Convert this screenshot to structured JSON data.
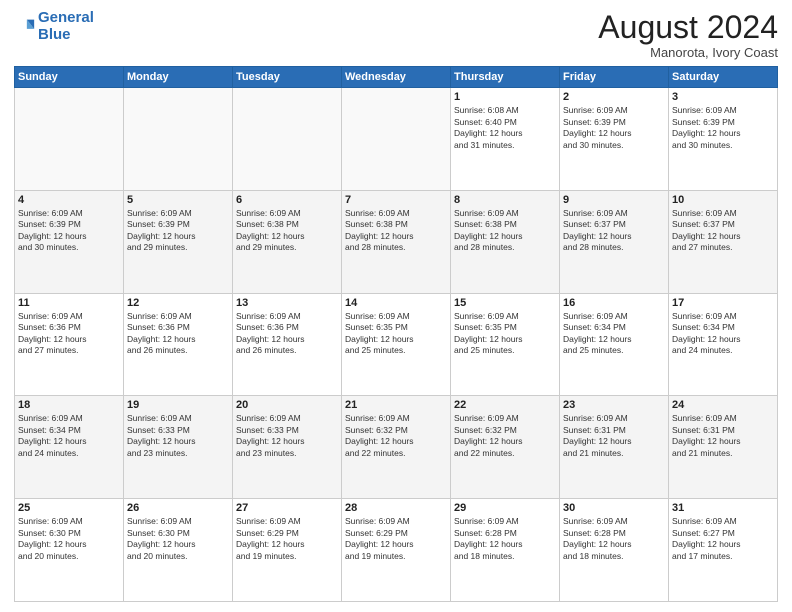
{
  "header": {
    "logo_line1": "General",
    "logo_line2": "Blue",
    "month_year": "August 2024",
    "location": "Manorota, Ivory Coast"
  },
  "weekdays": [
    "Sunday",
    "Monday",
    "Tuesday",
    "Wednesday",
    "Thursday",
    "Friday",
    "Saturday"
  ],
  "weeks": [
    [
      {
        "day": "",
        "info": ""
      },
      {
        "day": "",
        "info": ""
      },
      {
        "day": "",
        "info": ""
      },
      {
        "day": "",
        "info": ""
      },
      {
        "day": "1",
        "info": "Sunrise: 6:08 AM\nSunset: 6:40 PM\nDaylight: 12 hours\nand 31 minutes."
      },
      {
        "day": "2",
        "info": "Sunrise: 6:09 AM\nSunset: 6:39 PM\nDaylight: 12 hours\nand 30 minutes."
      },
      {
        "day": "3",
        "info": "Sunrise: 6:09 AM\nSunset: 6:39 PM\nDaylight: 12 hours\nand 30 minutes."
      }
    ],
    [
      {
        "day": "4",
        "info": "Sunrise: 6:09 AM\nSunset: 6:39 PM\nDaylight: 12 hours\nand 30 minutes."
      },
      {
        "day": "5",
        "info": "Sunrise: 6:09 AM\nSunset: 6:39 PM\nDaylight: 12 hours\nand 29 minutes."
      },
      {
        "day": "6",
        "info": "Sunrise: 6:09 AM\nSunset: 6:38 PM\nDaylight: 12 hours\nand 29 minutes."
      },
      {
        "day": "7",
        "info": "Sunrise: 6:09 AM\nSunset: 6:38 PM\nDaylight: 12 hours\nand 28 minutes."
      },
      {
        "day": "8",
        "info": "Sunrise: 6:09 AM\nSunset: 6:38 PM\nDaylight: 12 hours\nand 28 minutes."
      },
      {
        "day": "9",
        "info": "Sunrise: 6:09 AM\nSunset: 6:37 PM\nDaylight: 12 hours\nand 28 minutes."
      },
      {
        "day": "10",
        "info": "Sunrise: 6:09 AM\nSunset: 6:37 PM\nDaylight: 12 hours\nand 27 minutes."
      }
    ],
    [
      {
        "day": "11",
        "info": "Sunrise: 6:09 AM\nSunset: 6:36 PM\nDaylight: 12 hours\nand 27 minutes."
      },
      {
        "day": "12",
        "info": "Sunrise: 6:09 AM\nSunset: 6:36 PM\nDaylight: 12 hours\nand 26 minutes."
      },
      {
        "day": "13",
        "info": "Sunrise: 6:09 AM\nSunset: 6:36 PM\nDaylight: 12 hours\nand 26 minutes."
      },
      {
        "day": "14",
        "info": "Sunrise: 6:09 AM\nSunset: 6:35 PM\nDaylight: 12 hours\nand 25 minutes."
      },
      {
        "day": "15",
        "info": "Sunrise: 6:09 AM\nSunset: 6:35 PM\nDaylight: 12 hours\nand 25 minutes."
      },
      {
        "day": "16",
        "info": "Sunrise: 6:09 AM\nSunset: 6:34 PM\nDaylight: 12 hours\nand 25 minutes."
      },
      {
        "day": "17",
        "info": "Sunrise: 6:09 AM\nSunset: 6:34 PM\nDaylight: 12 hours\nand 24 minutes."
      }
    ],
    [
      {
        "day": "18",
        "info": "Sunrise: 6:09 AM\nSunset: 6:34 PM\nDaylight: 12 hours\nand 24 minutes."
      },
      {
        "day": "19",
        "info": "Sunrise: 6:09 AM\nSunset: 6:33 PM\nDaylight: 12 hours\nand 23 minutes."
      },
      {
        "day": "20",
        "info": "Sunrise: 6:09 AM\nSunset: 6:33 PM\nDaylight: 12 hours\nand 23 minutes."
      },
      {
        "day": "21",
        "info": "Sunrise: 6:09 AM\nSunset: 6:32 PM\nDaylight: 12 hours\nand 22 minutes."
      },
      {
        "day": "22",
        "info": "Sunrise: 6:09 AM\nSunset: 6:32 PM\nDaylight: 12 hours\nand 22 minutes."
      },
      {
        "day": "23",
        "info": "Sunrise: 6:09 AM\nSunset: 6:31 PM\nDaylight: 12 hours\nand 21 minutes."
      },
      {
        "day": "24",
        "info": "Sunrise: 6:09 AM\nSunset: 6:31 PM\nDaylight: 12 hours\nand 21 minutes."
      }
    ],
    [
      {
        "day": "25",
        "info": "Sunrise: 6:09 AM\nSunset: 6:30 PM\nDaylight: 12 hours\nand 20 minutes."
      },
      {
        "day": "26",
        "info": "Sunrise: 6:09 AM\nSunset: 6:30 PM\nDaylight: 12 hours\nand 20 minutes."
      },
      {
        "day": "27",
        "info": "Sunrise: 6:09 AM\nSunset: 6:29 PM\nDaylight: 12 hours\nand 19 minutes."
      },
      {
        "day": "28",
        "info": "Sunrise: 6:09 AM\nSunset: 6:29 PM\nDaylight: 12 hours\nand 19 minutes."
      },
      {
        "day": "29",
        "info": "Sunrise: 6:09 AM\nSunset: 6:28 PM\nDaylight: 12 hours\nand 18 minutes."
      },
      {
        "day": "30",
        "info": "Sunrise: 6:09 AM\nSunset: 6:28 PM\nDaylight: 12 hours\nand 18 minutes."
      },
      {
        "day": "31",
        "info": "Sunrise: 6:09 AM\nSunset: 6:27 PM\nDaylight: 12 hours\nand 17 minutes."
      }
    ]
  ]
}
